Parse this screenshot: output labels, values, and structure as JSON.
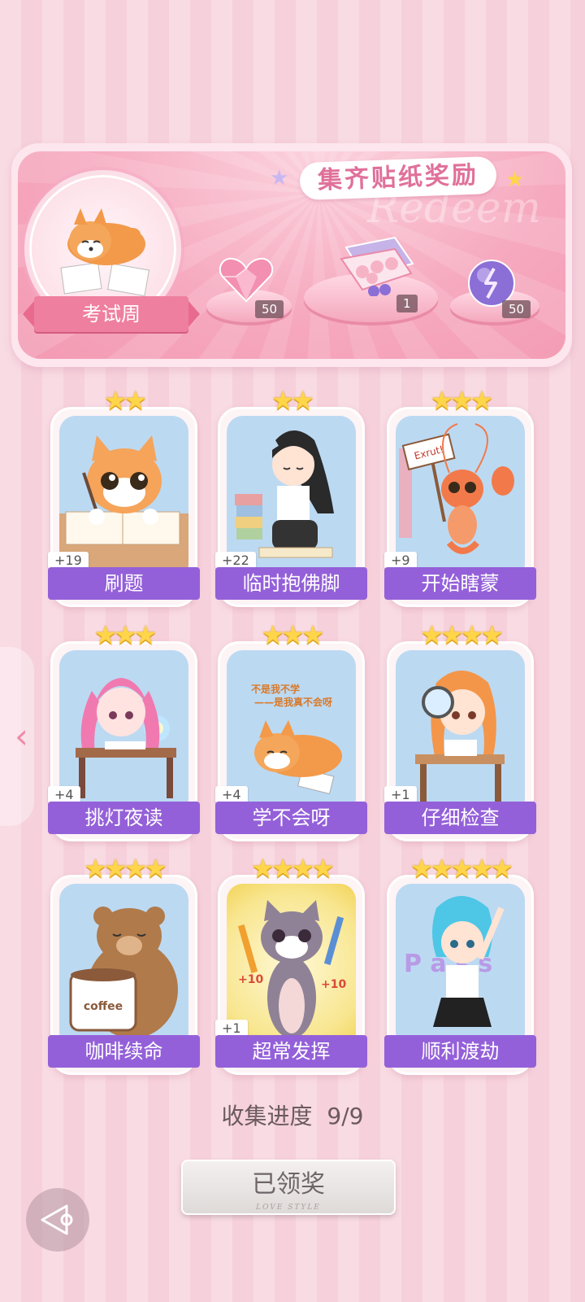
{
  "banner": {
    "title": "集齐贴纸奖励",
    "watermark": "Redeem",
    "theme_label": "考试周",
    "rewards": [
      {
        "icon": "pink-heart-gem-icon",
        "count": "50"
      },
      {
        "icon": "gift-box-icon",
        "count": "1"
      },
      {
        "icon": "purple-orb-icon",
        "count": "50"
      }
    ]
  },
  "stickers": [
    {
      "name": "刷题",
      "bonus": "+19",
      "stars": "★★",
      "art": "cat-studying"
    },
    {
      "name": "临时抱佛脚",
      "bonus": "+22",
      "stars": "★★",
      "art": "girl-praying"
    },
    {
      "name": "开始瞎蒙",
      "bonus": "+9",
      "stars": "★★★",
      "art": "shrimp-sign",
      "sign_text": "Exrut!"
    },
    {
      "name": "挑灯夜读",
      "bonus": "+4",
      "stars": "★★★",
      "art": "girl-desk-lamp"
    },
    {
      "name": "学不会呀",
      "bonus": "+4",
      "stars": "★★★",
      "art": "dog-lying",
      "caption_line1": "不是我不学",
      "caption_line2": "——是我真不会呀"
    },
    {
      "name": "仔细检查",
      "bonus": "+1",
      "stars": "★★★★",
      "art": "girl-magnifier"
    },
    {
      "name": "咖啡续命",
      "bonus": "",
      "stars": "★★★★",
      "art": "bear-coffee",
      "cup_text": "coffee"
    },
    {
      "name": "超常发挥",
      "bonus": "+1",
      "stars": "★★★★",
      "art": "cat-pencils",
      "left_bonus": "+10",
      "right_bonus": "+10"
    },
    {
      "name": "顺利渡劫",
      "bonus": "",
      "stars": "★★★★★",
      "art": "girl-pass",
      "letters": "P a s s"
    }
  ],
  "progress": {
    "label": "收集进度",
    "value": "9/9"
  },
  "claim_button": {
    "label": "已领奖",
    "sub": "LOVE STYLE"
  },
  "colors": {
    "label_purple": "#9460d9",
    "banner_pink": "#f39ab3",
    "star_gold": "#ffd54a"
  }
}
